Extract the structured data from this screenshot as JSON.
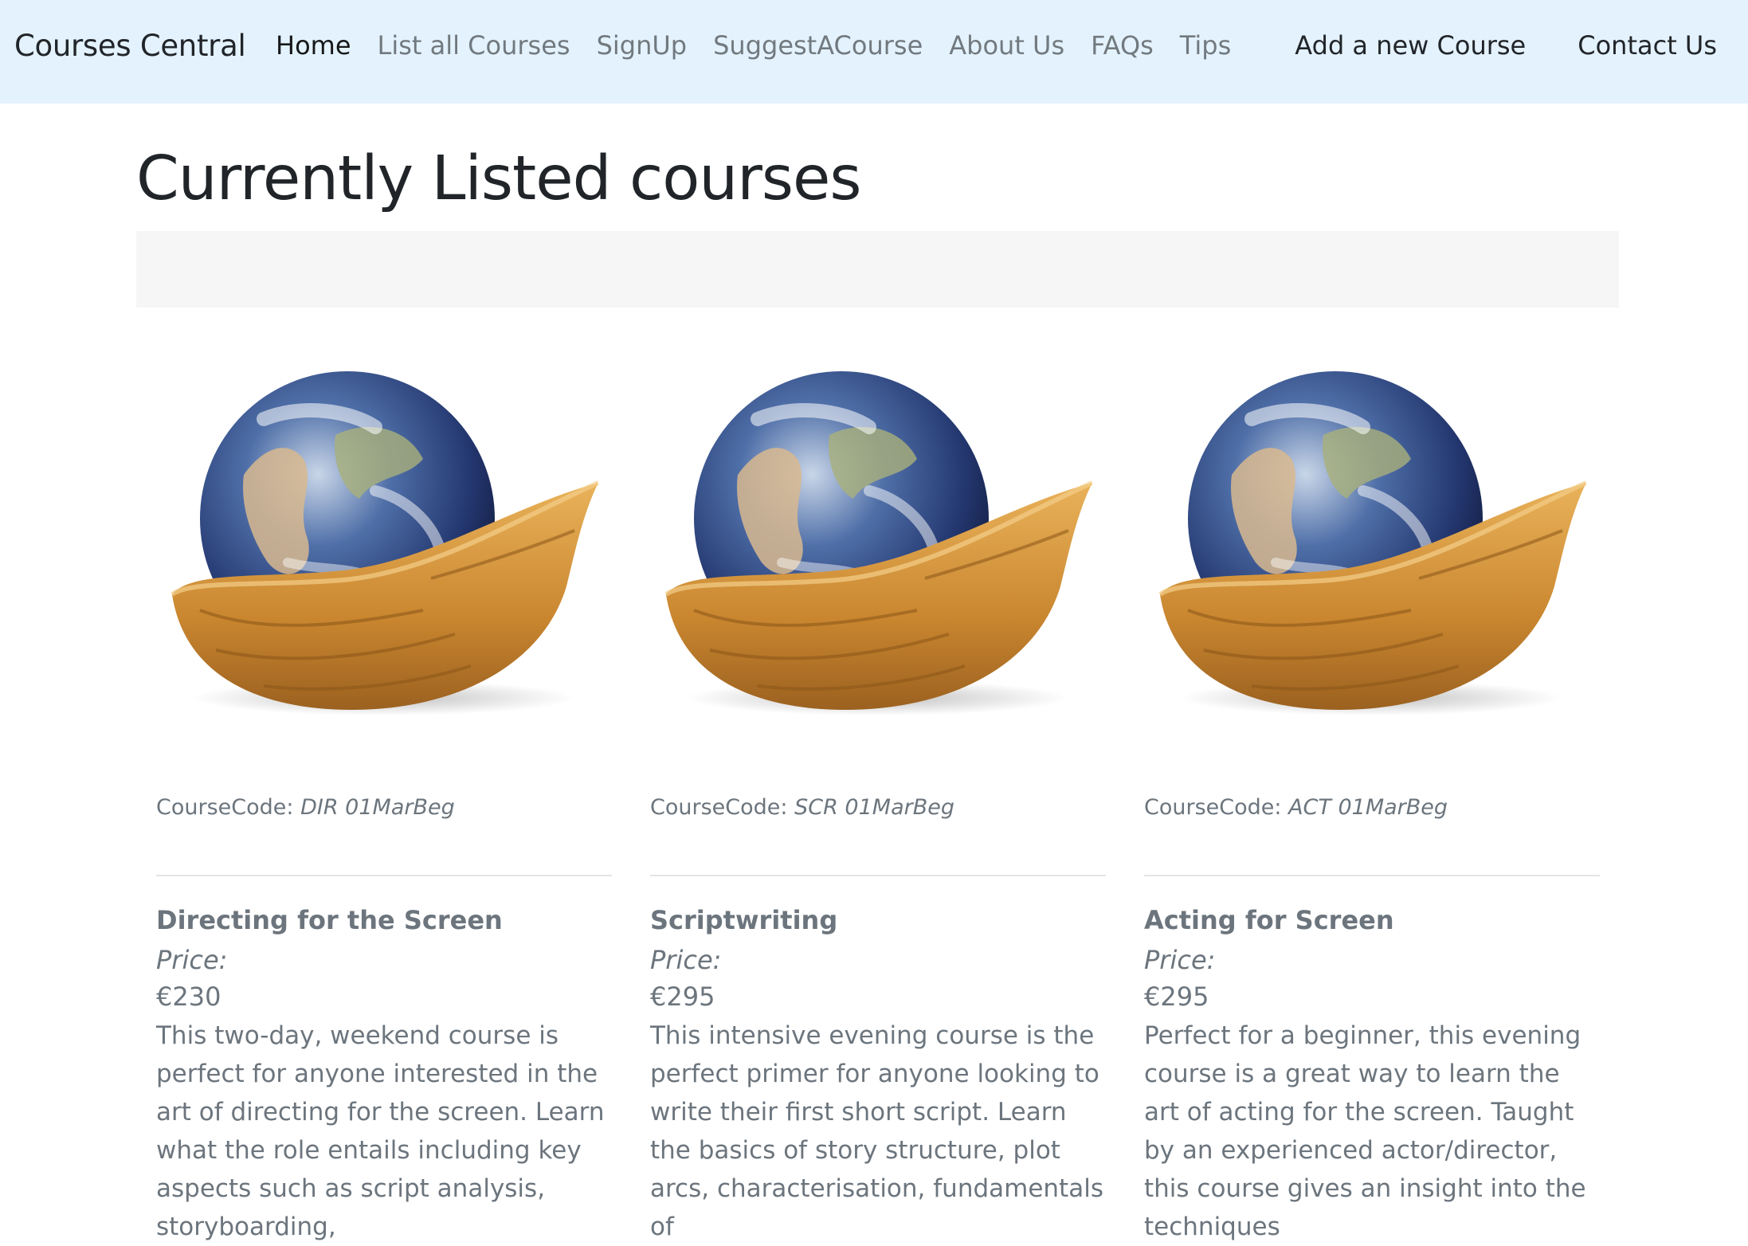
{
  "navbar": {
    "brand": "Courses Central",
    "links": [
      "Home",
      "List all Courses",
      "SignUp",
      "SuggestACourse",
      "About Us",
      "FAQs",
      "Tips"
    ],
    "right_links": [
      "Add a new Course",
      "Contact Us"
    ],
    "bg_color": "#e3f2fd"
  },
  "page": {
    "title": "Currently Listed courses"
  },
  "courses": [
    {
      "code_label": "CourseCode:",
      "code": "DIR 01MarBeg",
      "title": "Directing for the Screen",
      "price_label": "Price:",
      "price": "€230",
      "description": "This two-day, weekend course is perfect for anyone interested in the art of directing for the screen. Learn what the role entails including key aspects such as script analysis, storyboarding,"
    },
    {
      "code_label": "CourseCode:",
      "code": "SCR 01MarBeg",
      "title": "Scriptwriting",
      "price_label": "Price:",
      "price": "€295",
      "description": "This intensive evening course is the perfect primer for anyone looking to write their first short script. Learn the basics of story structure, plot arcs, characterisation, fundamentals of"
    },
    {
      "code_label": "CourseCode:",
      "code": "ACT 01MarBeg",
      "title": "Acting for Screen",
      "price_label": "Price:",
      "price": "€295",
      "description": "Perfect for a beginner, this evening course is a great way to learn the art of acting for the screen. Taught by an experienced actor/director, this course gives an insight into the techniques"
    }
  ]
}
